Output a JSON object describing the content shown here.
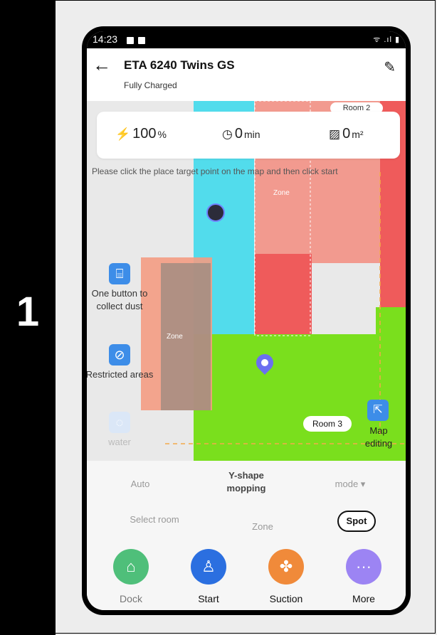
{
  "step": {
    "number": "1"
  },
  "status_bar": {
    "time": "14:23",
    "signal": "ᯤ .ıl ▮"
  },
  "header": {
    "back_icon": "←",
    "title": "ETA 6240 Twins GS",
    "subtitle": "Fully Charged",
    "edit_icon": "✎"
  },
  "stats": [
    {
      "icon": "⚡",
      "value": "100",
      "unit": "%"
    },
    {
      "icon": "◷",
      "value": "0",
      "unit": "min"
    },
    {
      "icon": "▨",
      "value": "0",
      "unit": "m²"
    }
  ],
  "map": {
    "hint": "Please click the place target point on the map and then click start",
    "room_top_label": "Room 2",
    "room3_label": "Room 3",
    "zone_label": "Zone",
    "map_edit_icon": "⇱",
    "map_edit_label": "Map editing",
    "colors": {
      "cyan": "#52dcec",
      "pink": "#f29a8f",
      "red": "#ef5b5b",
      "green": "#7adf1d",
      "orange": "#f49c83",
      "brown": "#9a8a80"
    }
  },
  "tools": [
    {
      "icon": "⌸",
      "label": "One button to collect dust"
    },
    {
      "icon": "⊘",
      "label": "Restricted areas"
    },
    {
      "icon": "◌",
      "label": "water"
    }
  ],
  "modes": {
    "auto": "Auto",
    "yshape": "Y-shape mopping",
    "mode": "mode ▾",
    "select_room": "Select room",
    "zone": "Zone",
    "spot": "Spot"
  },
  "actions": [
    {
      "label": "Dock",
      "icon": "⌂",
      "color": "#4fbf7a"
    },
    {
      "label": "Start",
      "icon": "♙",
      "color": "#2b6fe0"
    },
    {
      "label": "Suction",
      "icon": "✤",
      "color": "#f08a3a"
    },
    {
      "label": "More",
      "icon": "···",
      "color": "#9c84f3"
    }
  ]
}
